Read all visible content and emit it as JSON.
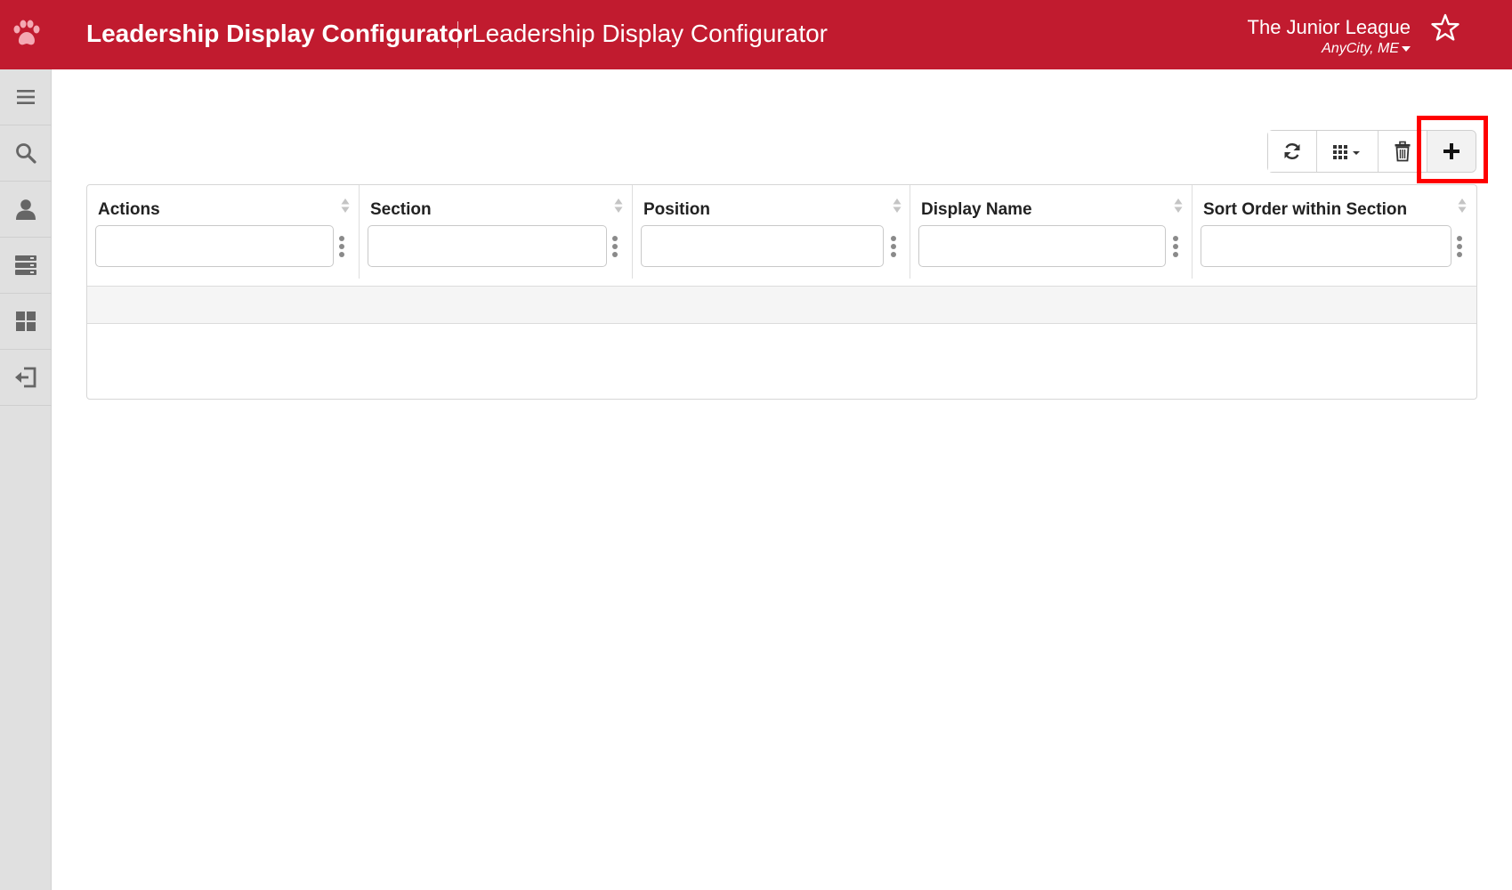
{
  "header": {
    "title": "Leadership Display Configurator",
    "subtitle": "Leadership Display Configurator",
    "org_name": "The Junior League",
    "org_location": "AnyCity, ME",
    "brand_color": "#c11b2f"
  },
  "sidebar": {
    "items": [
      {
        "icon": "menu-icon"
      },
      {
        "icon": "search-icon"
      },
      {
        "icon": "user-icon"
      },
      {
        "icon": "database-icon"
      },
      {
        "icon": "dashboard-icon"
      },
      {
        "icon": "logout-icon"
      }
    ]
  },
  "toolbar": {
    "buttons": [
      {
        "icon": "refresh-icon"
      },
      {
        "icon": "grid-columns-icon"
      },
      {
        "icon": "trash-icon"
      },
      {
        "icon": "plus-icon"
      }
    ],
    "highlight_color": "#ff0000"
  },
  "table": {
    "columns": [
      {
        "label": "Actions",
        "filter_value": ""
      },
      {
        "label": "Section",
        "filter_value": ""
      },
      {
        "label": "Position",
        "filter_value": ""
      },
      {
        "label": "Display Name",
        "filter_value": ""
      },
      {
        "label": "Sort Order within Section",
        "filter_value": ""
      }
    ],
    "rows": []
  }
}
